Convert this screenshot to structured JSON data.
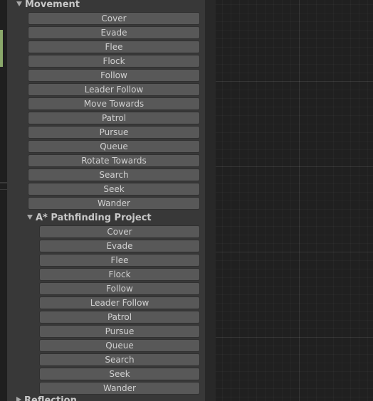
{
  "categories": [
    {
      "title": "Movement",
      "items": [
        "Cover",
        "Evade",
        "Flee",
        "Flock",
        "Follow",
        "Leader Follow",
        "Move Towards",
        "Patrol",
        "Pursue",
        "Queue",
        "Rotate Towards",
        "Search",
        "Seek",
        "Wander"
      ]
    },
    {
      "title": "A* Pathfinding Project",
      "items": [
        "Cover",
        "Evade",
        "Flee",
        "Flock",
        "Follow",
        "Leader Follow",
        "Patrol",
        "Pursue",
        "Queue",
        "Search",
        "Seek",
        "Wander"
      ]
    },
    {
      "title": "Reflection",
      "items": []
    }
  ],
  "colors": {
    "button_bg": "#585858",
    "panel_bg": "#383838",
    "graph_bg": "#202020"
  },
  "icons": {
    "expand": "triangle-down-icon"
  }
}
